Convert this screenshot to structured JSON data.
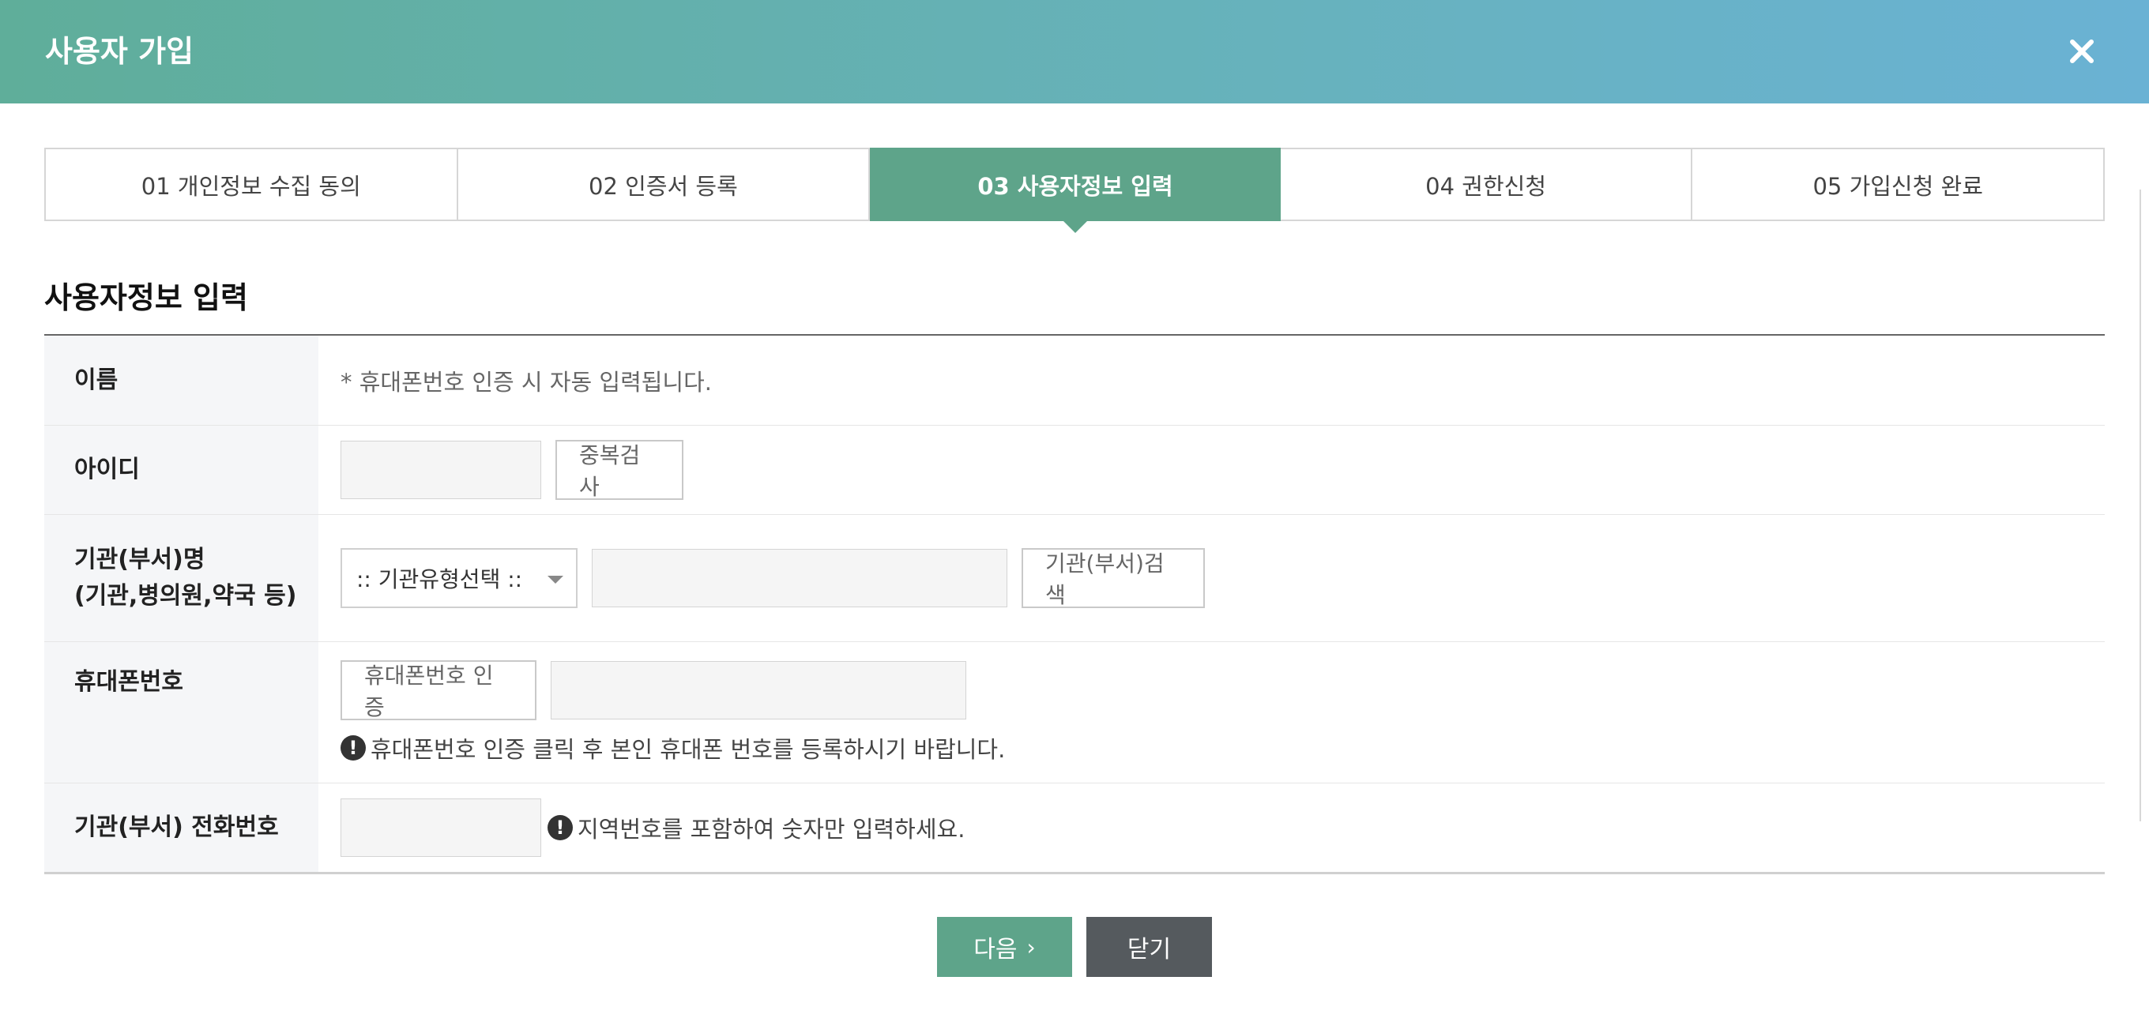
{
  "header": {
    "title": "사용자 가입",
    "close_icon": "close-icon"
  },
  "steps": [
    {
      "label": "01 개인정보 수집 동의",
      "active": false
    },
    {
      "label": "02 인증서 등록",
      "active": false
    },
    {
      "label": "03 사용자정보 입력",
      "active": true
    },
    {
      "label": "04 권한신청",
      "active": false
    },
    {
      "label": "05 가입신청 완료",
      "active": false
    }
  ],
  "section": {
    "title": "사용자정보 입력"
  },
  "form": {
    "name": {
      "label": "이름",
      "note": "* 휴대폰번호 인증 시 자동 입력됩니다."
    },
    "id": {
      "label": "아이디",
      "value": "",
      "check_button": "중복검사"
    },
    "org": {
      "label_line1": "기관(부서)명",
      "label_line2": "(기관,병의원,약국 등)",
      "select_value": ":: 기관유형선택 ::",
      "value": "",
      "search_button": "기관(부서)검색"
    },
    "phone": {
      "label": "휴대폰번호",
      "verify_button": "휴대폰번호 인증",
      "value": "",
      "note": "휴대폰번호 인증 클릭 후 본인 휴대폰 번호를 등록하시기 바랍니다."
    },
    "tel": {
      "label": "기관(부서) 전화번호",
      "value": "",
      "note": "지역번호를 포함하여 숫자만 입력하세요."
    }
  },
  "footer": {
    "next_label": "다음",
    "next_icon": "chevron-right-icon",
    "close_label": "닫기"
  },
  "colors": {
    "accent": "#5ea48a",
    "header_start": "#5fae9a",
    "header_end": "#6ab2d4",
    "dark_button": "#555a5e"
  }
}
